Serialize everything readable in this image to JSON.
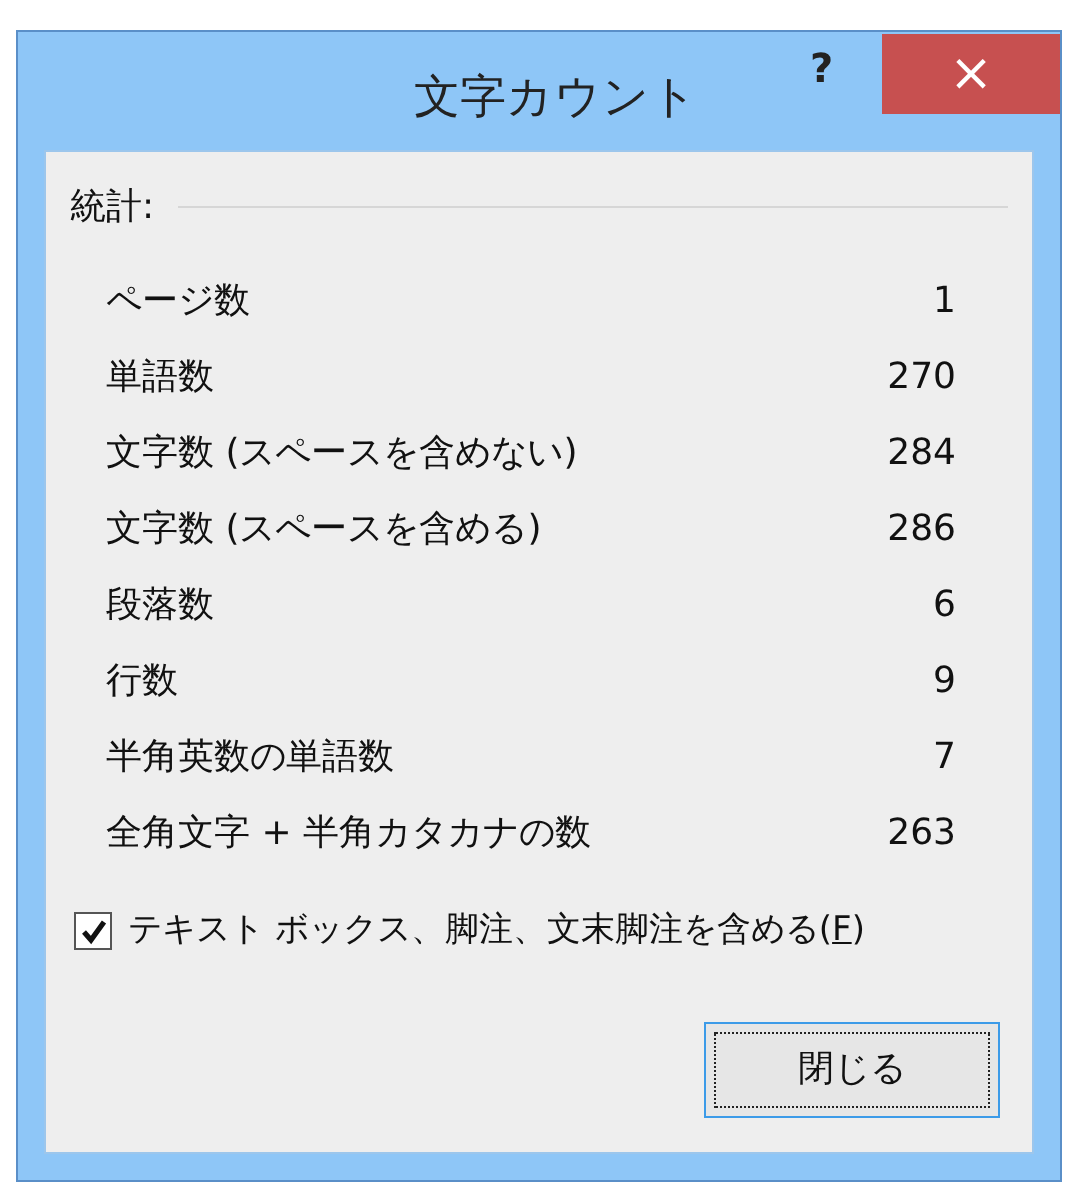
{
  "window": {
    "title": "文字カウント",
    "help": "?",
    "close": "×"
  },
  "section": {
    "label": "統計:"
  },
  "stats": [
    {
      "label": "ページ数",
      "value": "1"
    },
    {
      "label": "単語数",
      "value": "270"
    },
    {
      "label": "文字数 (スペースを含めない)",
      "value": "284"
    },
    {
      "label": "文字数 (スペースを含める)",
      "value": "286"
    },
    {
      "label": "段落数",
      "value": "6"
    },
    {
      "label": "行数",
      "value": "9"
    },
    {
      "label": "半角英数の単語数",
      "value": "7"
    },
    {
      "label": "全角文字 + 半角カタカナの数",
      "value": "263"
    }
  ],
  "include_option": {
    "label": "テキスト ボックス、脚注、文末脚注を含める(",
    "access_key": "F",
    "label_end": ")",
    "checked": true
  },
  "buttons": [
    {
      "label": "閉じる"
    }
  ]
}
